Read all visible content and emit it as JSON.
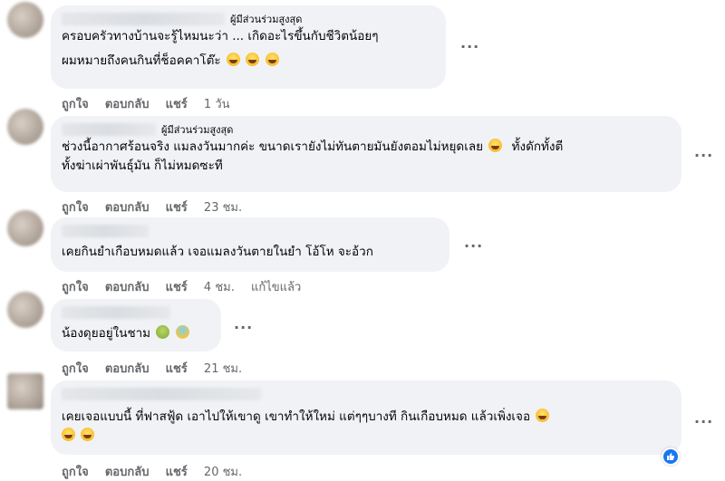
{
  "comments": [
    {
      "badge": "ผู้มีส่วนร่วมสูงสุด",
      "lines": [
        "ครอบครัวทางบ้านจะรู้ไหมนะว่า ... เกิดอะไรขึ้นกับชีวิตน้อยๆ",
        "ผมหมายถึงคนกินที่ช็อคคาโต๊ะ"
      ],
      "emoji_count": 3,
      "like": "ถูกใจ",
      "reply": "ตอบกลับ",
      "share": "แชร์",
      "time": "1 วัน"
    },
    {
      "badge": "ผู้มีส่วนร่วมสูงสุด",
      "lines": [
        "ช่วงนี้อากาศร้อนจริง แมลงวันมากค่ะ ขนาดเรายังไม่ทันตายมันยังตอมไม่หยุดเลย",
        "ทั้งฆ่าเผ่าพันธุ์มัน ก็ไม่หมดซะที"
      ],
      "line1_tail": "ทั้งดักทั้งตี",
      "like": "ถูกใจ",
      "reply": "ตอบกลับ",
      "share": "แชร์",
      "time": "23 ชม."
    },
    {
      "lines": [
        "เคยกินยำเกือบหมดแล้ว เจอแมลงวันตายในยำ โอ้โห จะอ้วก"
      ],
      "like": "ถูกใจ",
      "reply": "ตอบกลับ",
      "share": "แชร์",
      "time": "4 ชม.",
      "edited": "แก้ไขแล้ว"
    },
    {
      "lines": [
        "น้องดุยอยู่ในชาม"
      ],
      "like": "ถูกใจ",
      "reply": "ตอบกลับ",
      "share": "แชร์",
      "time": "21 ชม."
    },
    {
      "lines": [
        "เคยเจอแบบนี้ ที่ฟาสฟู้ด เอาไปให้เขาดู เขาทำให้ใหม่ แต่ๆๆบางที กินเกือบหมด แล้วเพิ่งเจอ"
      ],
      "like": "ถูกใจ",
      "reply": "ตอบกลับ",
      "share": "แชร์",
      "time": "20 ชม."
    }
  ],
  "more_label": "...",
  "icons": {
    "more": "more-horizontal-icon",
    "reaction": "like-reaction-icon",
    "emoji": "laughing-emoji-icon"
  },
  "colors": {
    "bubble": "#f0f2f5",
    "meta": "#65676b",
    "reaction": "#1877f2"
  }
}
